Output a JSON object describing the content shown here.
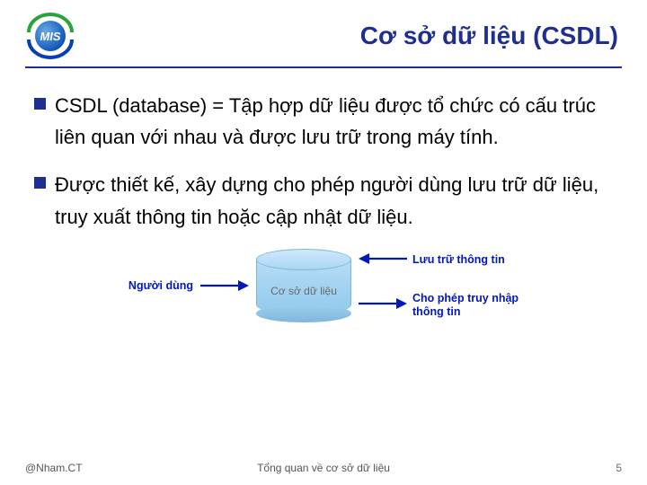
{
  "logo": {
    "text": "MIS",
    "ring_top_color": "#2aa33a",
    "ring_bottom_color": "#0a3fb3",
    "inner_gradient_from": "#0b53b5",
    "inner_gradient_to": "#6aa8e6"
  },
  "title": "Cơ sở dữ liệu (CSDL)",
  "bullets": [
    "CSDL (database) = Tập hợp dữ liệu được tổ chức có cấu trúc liên quan với nhau và được lưu trữ trong máy tính.",
    "Được thiết kế, xây dựng cho phép người dùng lưu trữ dữ liệu, truy xuất thông tin hoặc cập nhật dữ liệu."
  ],
  "diagram": {
    "user_label": "Người dùng",
    "db_label": "Cơ sở dữ liệu",
    "store_label": "Lưu trữ thông tin",
    "access_label": "Cho phép truy nhập\nthông tin",
    "arrow_color": "#0018c0"
  },
  "footer": {
    "left": "@Nham.CT",
    "center": "Tổng quan về cơ sở dữ liệu",
    "page": "5"
  }
}
